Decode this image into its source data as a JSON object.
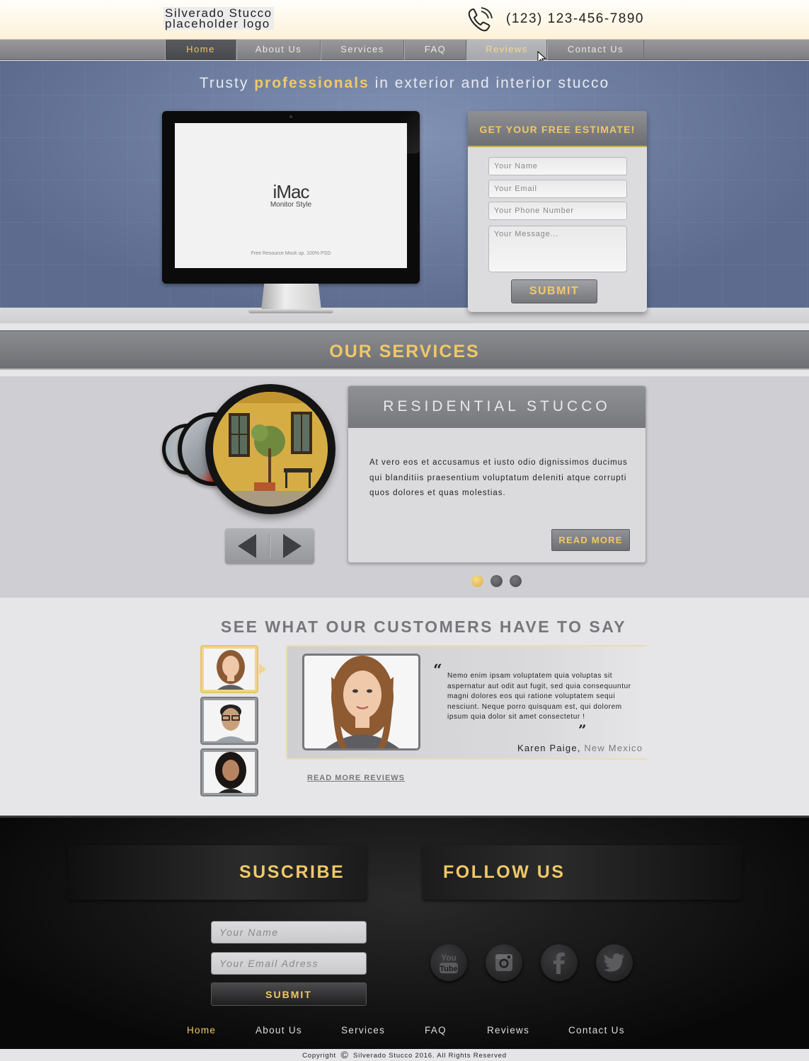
{
  "header": {
    "logo_text": "Silverado Stucco placeholder logo",
    "phone": "(123) 123-456-7890"
  },
  "nav": {
    "items": [
      {
        "label": "Home",
        "state": "active"
      },
      {
        "label": "About Us",
        "state": "normal"
      },
      {
        "label": "Services",
        "state": "normal"
      },
      {
        "label": "FAQ",
        "state": "normal"
      },
      {
        "label": "Reviews",
        "state": "hover"
      },
      {
        "label": "Contact Us",
        "state": "normal"
      }
    ]
  },
  "hero": {
    "title_before": "Trusty ",
    "title_highlight": "professionals",
    "title_after": " in exterior and interior stucco",
    "imac_brand": "iMac",
    "imac_sub": "Monitor Style",
    "imac_foot": "Free Resource Mock up. 100% PSD"
  },
  "estimate": {
    "title": "GET YOUR FREE ESTIMATE!",
    "name_placeholder": "Your Name",
    "email_placeholder": "Your Email",
    "phone_placeholder": "Your Phone Number",
    "message_placeholder": "Your Message...",
    "submit_label": "SUBMIT"
  },
  "services": {
    "section_title": "OUR SERVICES",
    "card_title": "RESIDENTIAL STUCCO",
    "card_text": "At vero eos et accusamus et iusto odio dignissimos ducimus qui blanditiis praesentium voluptatum deleniti atque corrupti quos dolores et quas molestias.",
    "read_more_label": "READ MORE",
    "dots": [
      {
        "state": "active"
      },
      {
        "state": "inactive"
      },
      {
        "state": "inactive"
      }
    ]
  },
  "testimonials": {
    "section_title": "SEE WHAT OUR CUSTOMERS HAVE TO SAY",
    "quote_open": "“",
    "quote_close": "”",
    "quote": "Nemo enim ipsam voluptatem quia voluptas sit aspernatur aut odit aut fugit, sed quia consequuntur magni dolores eos qui ratione voluptatem sequi nesciunt. Neque porro quisquam est, qui dolorem ipsum quia dolor sit amet consectetur !",
    "author": "Karen Paige, ",
    "location": "New Mexico",
    "read_more_reviews": "READ MORE REVIEWS"
  },
  "footer": {
    "subscribe_title": "SUSCRIBE",
    "follow_title": "FOLLOW US",
    "name_placeholder": "Your Name",
    "email_placeholder": "Your Email Adress",
    "submit_label": "SUBMIT",
    "social": [
      {
        "icon": "youtube-icon",
        "label": "You Tube"
      },
      {
        "icon": "instagram-icon"
      },
      {
        "icon": "facebook-icon",
        "label": "f"
      },
      {
        "icon": "twitter-icon"
      }
    ],
    "nav": [
      "Home",
      "About Us",
      "Services",
      "FAQ",
      "Reviews",
      "Contact Us"
    ],
    "copyright_before": "Copyright",
    "copyright_symbol": "©",
    "copyright_after": "Silverado Stucco 2016. All Rights Reserved"
  },
  "colors": {
    "accent_gold": "#f0c866",
    "hero_blue": "#6f7fa1",
    "nav_gray": "#8b8c90",
    "footer_black": "#0f0f10"
  }
}
